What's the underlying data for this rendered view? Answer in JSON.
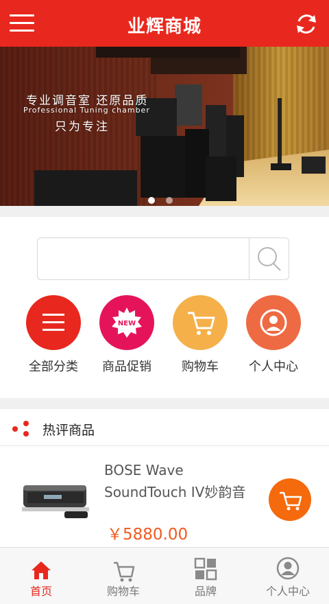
{
  "colors": {
    "brand": "#e8281e",
    "price": "#f05a1e",
    "cart_button": "#f46a0c"
  },
  "header": {
    "title": "业辉商城",
    "menu_icon": "hamburger-menu-icon",
    "refresh_icon": "refresh-icon"
  },
  "banner": {
    "line1": "专业调音室 还原品质",
    "line2": "Professional Tuning chamber",
    "line3": "只为专注",
    "slides": 2,
    "active_slide": 1
  },
  "search": {
    "placeholder": "",
    "value": "",
    "icon": "search-icon"
  },
  "shortcuts": [
    {
      "label": "全部分类",
      "icon": "menu-lines-icon",
      "color": "#e8281e"
    },
    {
      "label": "商品促销",
      "icon": "new-badge-icon",
      "color": "#e5145a"
    },
    {
      "label": "购物车",
      "icon": "cart-icon",
      "color": "#f5b04a"
    },
    {
      "label": "个人中心",
      "icon": "user-icon",
      "color": "#ee6a42"
    }
  ],
  "section": {
    "title": "热评商品",
    "icon": "dots-icon"
  },
  "products": [
    {
      "name": "BOSE Wave SoundTouch IV妙韵音",
      "price": "￥5880.00"
    }
  ],
  "bottom_nav": [
    {
      "label": "首页",
      "icon": "home-icon",
      "active": true
    },
    {
      "label": "购物车",
      "icon": "cart-icon",
      "active": false
    },
    {
      "label": "品牌",
      "icon": "grid-icon",
      "active": false
    },
    {
      "label": "个人中心",
      "icon": "user-icon",
      "active": false
    }
  ]
}
